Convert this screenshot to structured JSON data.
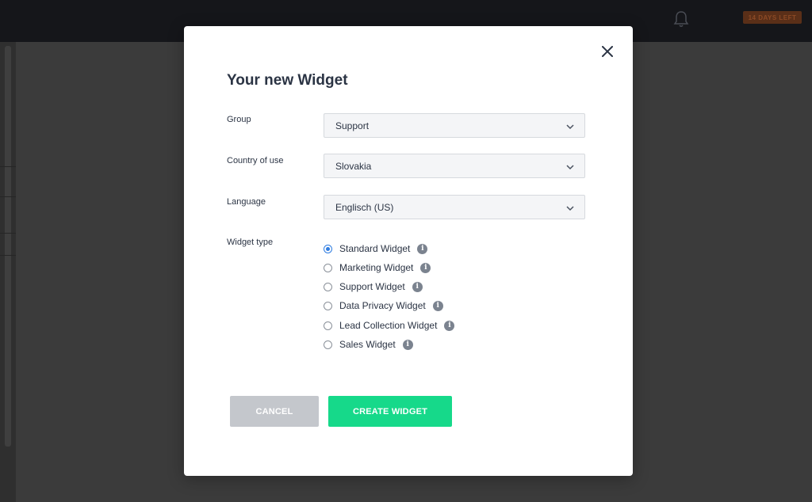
{
  "header": {
    "trial_badge": "14 DAYS LEFT",
    "icons": [
      "bell-icon"
    ]
  },
  "modal": {
    "title": "Your new Widget",
    "close_icon": "close-icon",
    "fields": {
      "group": {
        "label": "Group",
        "value": "Support"
      },
      "country": {
        "label": "Country of use",
        "value": "Slovakia"
      },
      "language": {
        "label": "Language",
        "value": "Englisch (US)"
      }
    },
    "widget_type": {
      "label": "Widget type",
      "options": [
        {
          "label": "Standard Widget",
          "checked": true
        },
        {
          "label": "Marketing Widget",
          "checked": false
        },
        {
          "label": "Support Widget",
          "checked": false
        },
        {
          "label": "Data Privacy Widget",
          "checked": false
        },
        {
          "label": "Lead Collection Widget",
          "checked": false
        },
        {
          "label": "Sales Widget",
          "checked": false
        }
      ],
      "info_glyph": "i"
    },
    "buttons": {
      "cancel": "CANCEL",
      "create": "CREATE WIDGET"
    }
  },
  "colors": {
    "primary": "#16d98a",
    "cancel": "#c4c7cc",
    "radio_selected": "#2f7de1",
    "text": "#2b3444",
    "topbar": "#15161a",
    "badge": "#5a2f18"
  }
}
